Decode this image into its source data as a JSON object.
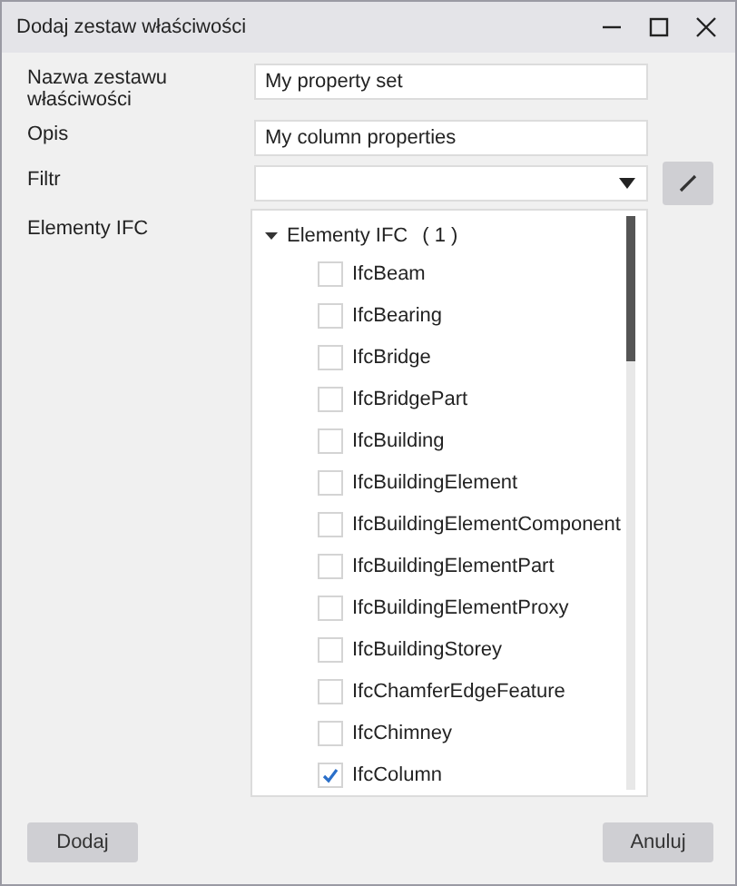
{
  "window": {
    "title": "Dodaj zestaw właściwości"
  },
  "fields": [
    {
      "label": "Nazwa zestawu właściwości",
      "value": "My property set",
      "kind": "text"
    },
    {
      "label": "Opis",
      "value": "My column properties",
      "kind": "text"
    },
    {
      "label": "Filtr",
      "kind": "dropdown"
    }
  ],
  "tree": {
    "label": "Elementy IFC",
    "root": {
      "label": "Elementy IFC",
      "count": "( 1 )",
      "expanded": true,
      "children": [
        {
          "label": "IfcBeam",
          "checked": false
        },
        {
          "label": "IfcBearing",
          "checked": false
        },
        {
          "label": "IfcBridge",
          "checked": false
        },
        {
          "label": "IfcBridgePart",
          "checked": false
        },
        {
          "label": "IfcBuilding",
          "checked": false
        },
        {
          "label": "IfcBuildingElement",
          "checked": false
        },
        {
          "label": "IfcBuildingElementComponent",
          "checked": false
        },
        {
          "label": "IfcBuildingElementPart",
          "checked": false
        },
        {
          "label": "IfcBuildingElementProxy",
          "checked": false
        },
        {
          "label": "IfcBuildingStorey",
          "checked": false
        },
        {
          "label": "IfcChamferEdgeFeature",
          "checked": false
        },
        {
          "label": "IfcChimney",
          "checked": false
        },
        {
          "label": "IfcColumn",
          "checked": true
        }
      ]
    }
  },
  "buttons": [
    "Dodaj",
    "Anuluj"
  ]
}
